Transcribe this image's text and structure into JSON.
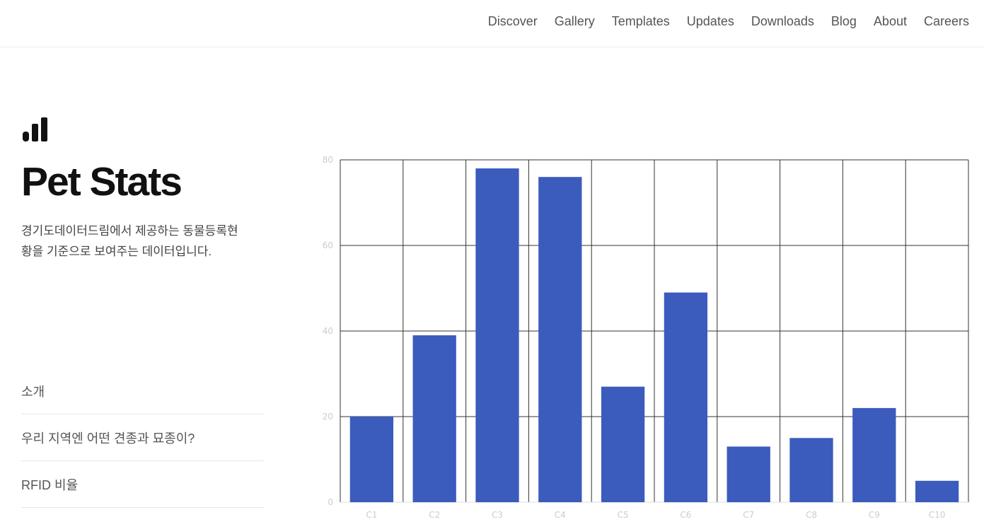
{
  "nav": {
    "items": [
      {
        "label": "Discover",
        "id": "discover"
      },
      {
        "label": "Gallery",
        "id": "gallery"
      },
      {
        "label": "Templates",
        "id": "templates"
      },
      {
        "label": "Updates",
        "id": "updates"
      },
      {
        "label": "Downloads",
        "id": "downloads"
      },
      {
        "label": "Blog",
        "id": "blog"
      },
      {
        "label": "About",
        "id": "about"
      },
      {
        "label": "Careers",
        "id": "careers"
      }
    ]
  },
  "hero": {
    "icon": "bar-chart-icon",
    "title": "Pet Stats",
    "description": "경기도데이터드림에서 제공하는 동물등록현황을 기준으로 보여주는 데이터입니다."
  },
  "menu": {
    "items": [
      {
        "label": "소개"
      },
      {
        "label": "우리 지역엔 어떤 견종과 묘종이?"
      },
      {
        "label": "RFID 비율"
      }
    ]
  },
  "colors": {
    "bar": "#3b5bbd",
    "grid": "#333333",
    "axis_text": "#cccccc"
  },
  "chart_data": {
    "type": "bar",
    "categories": [
      "C1",
      "C2",
      "C3",
      "C4",
      "C5",
      "C6",
      "C7",
      "C8",
      "C9",
      "C10"
    ],
    "values": [
      20,
      39,
      78,
      76,
      27,
      49,
      13,
      15,
      22,
      5
    ],
    "ylim": [
      0,
      80
    ],
    "yticks": [
      0,
      20,
      40,
      60,
      80
    ],
    "grid": true,
    "title": "",
    "xlabel": "",
    "ylabel": ""
  }
}
